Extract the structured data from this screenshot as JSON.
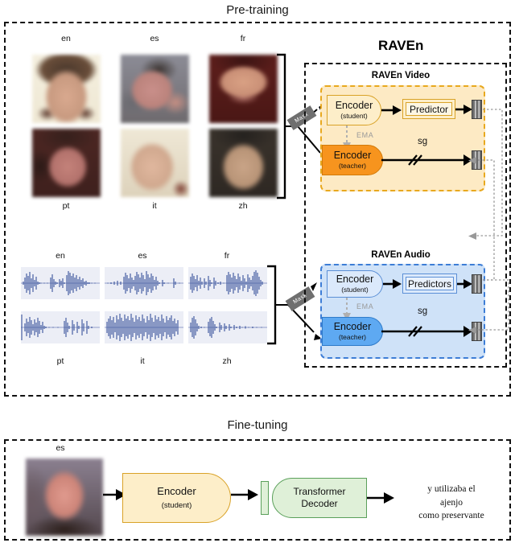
{
  "figure": {
    "pretraining_title": "Pre-training",
    "finetuning_title": "Fine-tuning",
    "framework_title": "RAVEn"
  },
  "pretraining": {
    "video_languages_top": [
      "en",
      "es",
      "fr"
    ],
    "video_languages_bottom": [
      "pt",
      "it",
      "zh"
    ],
    "audio_languages_top": [
      "en",
      "es",
      "fr"
    ],
    "audio_languages_bottom": [
      "pt",
      "it",
      "zh"
    ],
    "mask_label": "Mask",
    "video_branch": {
      "title": "RAVEn Video",
      "student_encoder": "Encoder",
      "student_role": "(student)",
      "teacher_encoder": "Encoder",
      "teacher_role": "(teacher)",
      "predictor": "Predictor",
      "ema_label": "EMA",
      "stopgrad_label": "sg"
    },
    "audio_branch": {
      "title": "RAVEn Audio",
      "student_encoder": "Encoder",
      "student_role": "(student)",
      "teacher_encoder": "Encoder",
      "teacher_role": "(teacher)",
      "predictor": "Predictors",
      "ema_label": "EMA",
      "stopgrad_label": "sg"
    }
  },
  "finetuning": {
    "language": "es",
    "encoder": "Encoder",
    "encoder_role": "(student)",
    "decoder_line1": "Transformer",
    "decoder_line2": "Decoder",
    "output_line1": "y utilizaba el",
    "output_line2": "ajenjo",
    "output_line3": "como preservante"
  },
  "colors": {
    "video_panel_fill": "#fdeac4",
    "video_panel_border": "#e8a81e",
    "audio_panel_fill": "#cfe2f8",
    "audio_panel_border": "#3d7dd6",
    "teacher_video_fill": "#f7941e",
    "teacher_audio_fill": "#5ea9f2",
    "decoder_fill": "#dff0d8",
    "decoder_border": "#5aa05a",
    "mask_fill": "#6f6f6f",
    "arrow": "#000000",
    "ema_arrow": "#b0b0b0"
  }
}
